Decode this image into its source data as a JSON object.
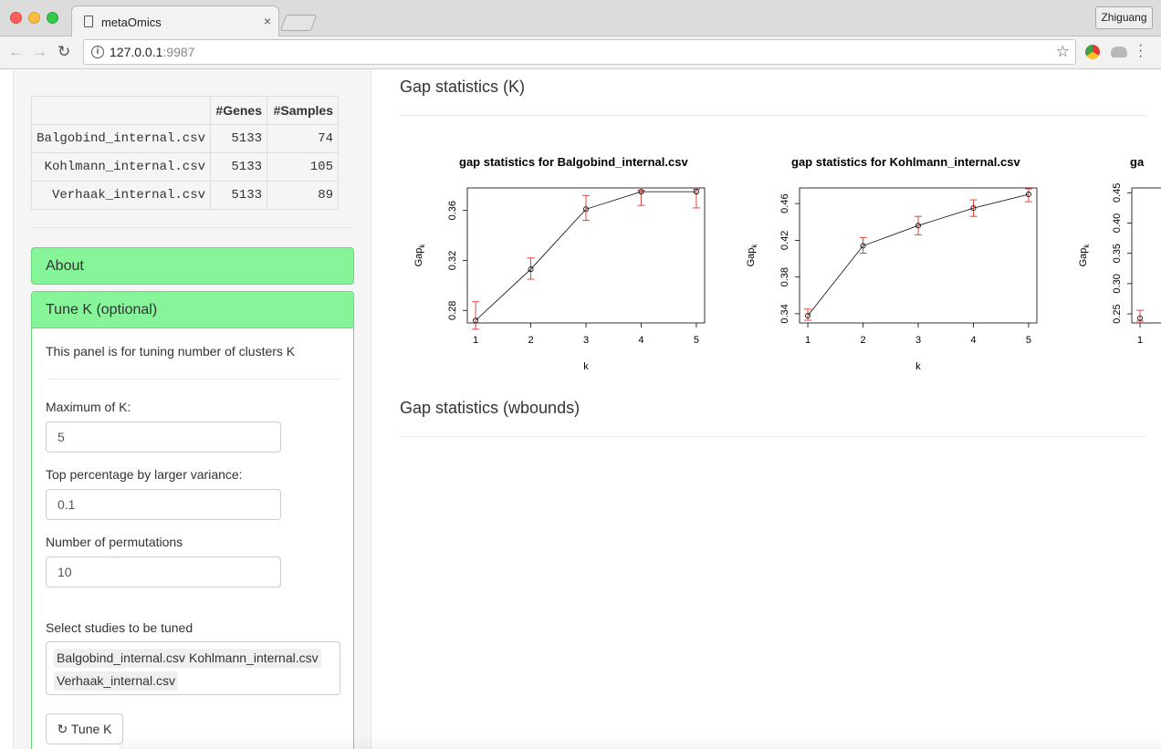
{
  "browser": {
    "tab_title": "metaOmics",
    "tab_close": "×",
    "profile_name": "Zhiguang",
    "url_host": "127.0.0.1",
    "url_port": ":9987",
    "icons": [
      "back-arrow-icon",
      "forward-arrow-icon",
      "reload-icon",
      "info-icon",
      "star-icon",
      "extension-icon",
      "drive-icon",
      "menu-icon"
    ]
  },
  "study_table": {
    "headers": [
      "",
      "#Genes",
      "#Samples"
    ],
    "rows": [
      {
        "file": "Balgobind_internal.csv",
        "genes": "5133",
        "samples": "74"
      },
      {
        "file": "Kohlmann_internal.csv",
        "genes": "5133",
        "samples": "105"
      },
      {
        "file": "Verhaak_internal.csv",
        "genes": "5133",
        "samples": "89"
      }
    ]
  },
  "sidebar": {
    "about_label": "About",
    "tune_label": "Tune K (optional)",
    "tune_description": "This panel is for tuning number of clusters K",
    "max_k_label": "Maximum of K:",
    "max_k_value": "5",
    "top_pct_label": "Top percentage by larger variance:",
    "top_pct_value": "0.1",
    "perm_label": "Number of permutations",
    "perm_value": "10",
    "select_label": "Select studies to be tuned",
    "selected_studies": [
      "Balgobind_internal.csv",
      "Kohlmann_internal.csv",
      "Verhaak_internal.csv"
    ],
    "tune_button_label": "Tune K",
    "tune_button_icon": "refresh-icon"
  },
  "main": {
    "section1_title": "Gap statistics (K)",
    "section2_title": "Gap statistics (wbounds)"
  },
  "chart_data": [
    {
      "type": "line",
      "title": "gap statistics for Balgobind_internal.csv",
      "xlabel": "k",
      "ylabel": "Gap",
      "ylabel_sub": "k",
      "x": [
        1,
        2,
        3,
        4,
        5
      ],
      "y": [
        0.272,
        0.313,
        0.361,
        0.375,
        0.375
      ],
      "err_low": [
        0.265,
        0.305,
        0.352,
        0.364,
        0.362
      ],
      "err_high": [
        0.287,
        0.322,
        0.372,
        0.376,
        0.377
      ],
      "xlim": [
        0.85,
        5.15
      ],
      "ylim": [
        0.27,
        0.378
      ],
      "xticks": [
        "1",
        "2",
        "3",
        "4",
        "5"
      ],
      "yticks": [
        0.28,
        0.32,
        0.36
      ],
      "ytick_labels": [
        "0.28",
        "0.32",
        "0.36"
      ],
      "line_color": "#000000",
      "error_color": "#e8413b"
    },
    {
      "type": "line",
      "title": "gap statistics for Kohlmann_internal.csv",
      "xlabel": "k",
      "ylabel": "Gap",
      "ylabel_sub": "k",
      "x": [
        1,
        2,
        3,
        4,
        5
      ],
      "y": [
        0.338,
        0.414,
        0.436,
        0.455,
        0.47
      ],
      "err_low": [
        0.333,
        0.406,
        0.426,
        0.446,
        0.462
      ],
      "err_high": [
        0.345,
        0.423,
        0.446,
        0.464,
        0.476
      ],
      "xlim": [
        0.85,
        5.15
      ],
      "ylim": [
        0.33,
        0.477
      ],
      "xticks": [
        "1",
        "2",
        "3",
        "4",
        "5"
      ],
      "yticks": [
        0.34,
        0.38,
        0.42,
        0.46
      ],
      "ytick_labels": [
        "0.34",
        "0.38",
        "0.42",
        "0.46"
      ],
      "line_color": "#000000",
      "error_color": "#e8413b"
    },
    {
      "type": "line",
      "title": "ga",
      "xlabel": "",
      "ylabel": "Gap",
      "ylabel_sub": "k",
      "x": [
        1
      ],
      "y": [
        0.243
      ],
      "err_low": [
        0.238
      ],
      "err_high": [
        0.256
      ],
      "xlim": [
        0.85,
        5.15
      ],
      "ylim": [
        0.235,
        0.458
      ],
      "xticks": [
        "1"
      ],
      "yticks": [
        0.25,
        0.3,
        0.35,
        0.4,
        0.45
      ],
      "ytick_labels": [
        "0.25",
        "0.30",
        "0.35",
        "0.40",
        "0.45"
      ],
      "line_color": "#000000",
      "error_color": "#e8413b"
    }
  ]
}
